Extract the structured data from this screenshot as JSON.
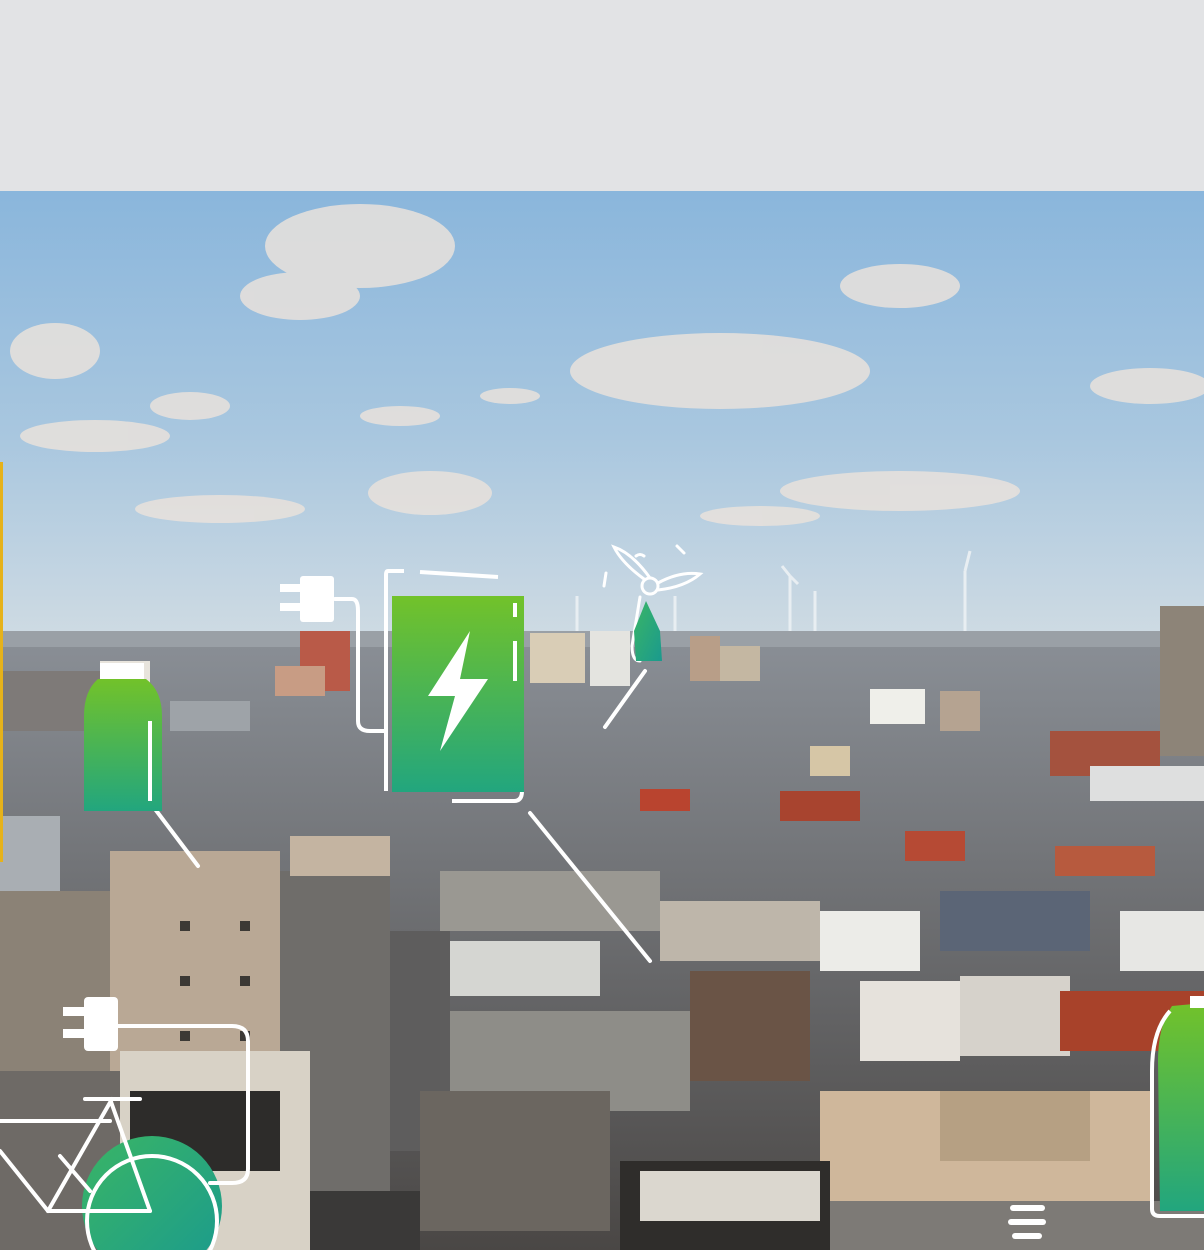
{
  "page": {
    "background": "#e2e3e5"
  },
  "hero": {
    "type": "aerial city skyline photograph with clean-energy icon overlays",
    "colors": {
      "sky_top": "#8fb9dc",
      "sky_bottom": "#c9dbe8",
      "accent_green": "#6cc12a",
      "accent_teal": "#1ea58a",
      "line_white": "#ffffff",
      "edge_yellow": "#e6b21a"
    },
    "overlay_icons": [
      "plug-icon",
      "charging-battery-icon",
      "lightning-bolt-icon",
      "wind-turbine-icon",
      "battery-icon",
      "bicycle-icon"
    ]
  }
}
